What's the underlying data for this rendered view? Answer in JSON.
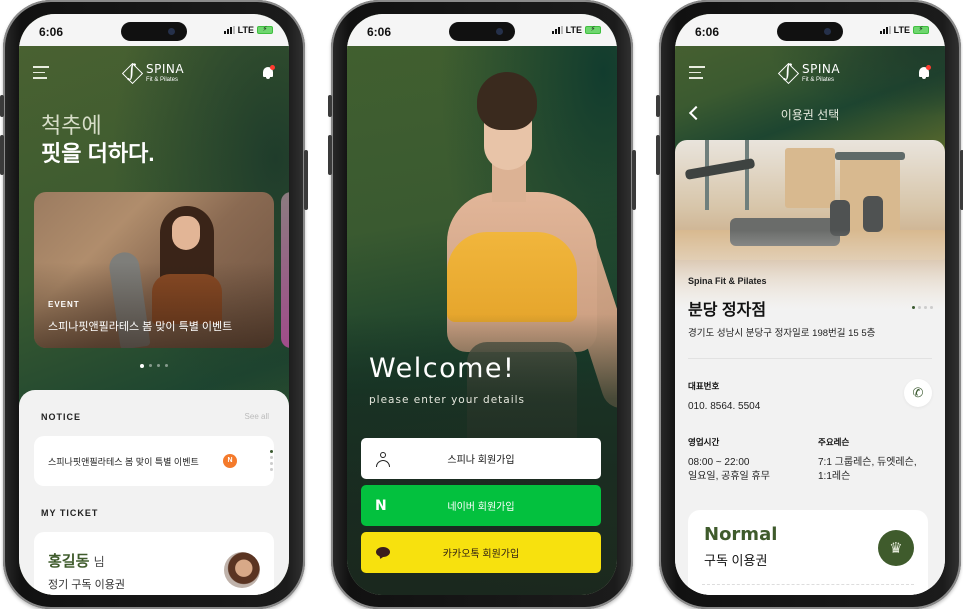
{
  "status_bar": {
    "time": "6:06",
    "network": "LTE"
  },
  "app": {
    "brand": "SPINA",
    "brand_sub": "Fit & Pilates",
    "menu_icon": "hamburger-menu-icon",
    "notification_icon": "bell-icon",
    "notification_dot_color": "#ff3b30"
  },
  "colors": {
    "brand_green": "#3f5b2c",
    "naver_green": "#03c13e",
    "kakao_yellow": "#f7e10e",
    "notice_badge": "#f47a2b"
  },
  "home": {
    "hero_line1": "척추에",
    "hero_line2": "핏을 더하다.",
    "event": {
      "label": "EVENT",
      "title": "스피나핏앤필라테스 봄 맞이 특별 이벤트"
    },
    "carousel": {
      "current": 1,
      "total": 4
    },
    "notice": {
      "section_title": "NOTICE",
      "see_all": "See all",
      "item_text": "스피나핏앤필라테스 봄 맞이 특별 이벤트",
      "badge": "N",
      "pager": {
        "current": 1,
        "total": 4
      }
    },
    "ticket": {
      "section_title": "MY TICKET",
      "user_name": "홍길동",
      "honorific": "님",
      "ticket_type": "정기 구독 이용권"
    }
  },
  "welcome": {
    "title": "Welcome!",
    "subtitle": "please enter your details",
    "buttons": [
      {
        "label": "스피나 회원가입",
        "icon": "user-icon"
      },
      {
        "label": "네이버 회원가입",
        "icon": "naver-icon",
        "icon_text": "N"
      },
      {
        "label": "카카오톡 회원가입",
        "icon": "kakao-icon"
      }
    ]
  },
  "ticket_select": {
    "title": "이용권 선택",
    "brand": "Spina Fit & Pilates",
    "branch": "분당 정자점",
    "address": "경기도 성남시 분당구 정자일로 198번길 15 5층",
    "image_pager": {
      "current": 1,
      "total": 4
    },
    "phone_label": "대표번호",
    "phone": "010. 8564. 5504",
    "hours_label": "영업시간",
    "hours": "08:00 ~ 22:00",
    "closed": "일요일, 공휴일 휴무",
    "lessons_label": "주요레슨",
    "lessons_line1": "7:1 그룹레슨, 듀엣레슨,",
    "lessons_line2": "1:1레슨",
    "plan": {
      "name": "Normal",
      "type": "구독 이용권",
      "icon": "crown-icon"
    }
  }
}
